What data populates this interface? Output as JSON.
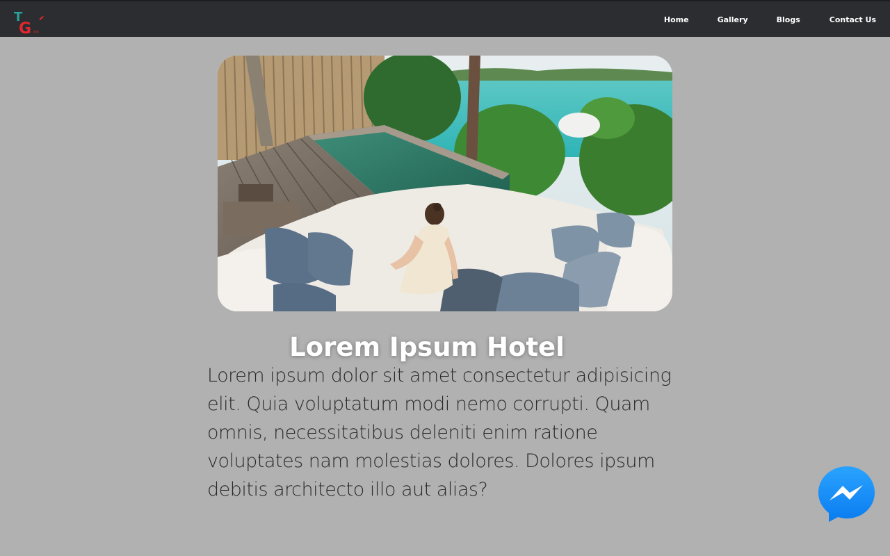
{
  "nav": {
    "logo_icon": "tg-travel-logo-icon",
    "links": [
      {
        "label": "Home"
      },
      {
        "label": "Gallery"
      },
      {
        "label": "Blogs"
      },
      {
        "label": "Contact Us"
      }
    ]
  },
  "hero": {
    "image_icon": "resort-villa-photo"
  },
  "content": {
    "title": "Lorem Ipsum Hotel",
    "description": "Lorem ipsum dolor sit amet consectetur adipisicing elit. Quia voluptatum modi nemo corrupti. Quam omnis, necessitatibus deleniti enim ratione voluptates nam molestias dolores. Dolores ipsum debitis architecto illo aut alias?"
  },
  "chat": {
    "icon": "messenger-icon",
    "color": "#1e90ff"
  },
  "colors": {
    "navbar": "#2b2d31",
    "background": "#b1b1b1"
  }
}
